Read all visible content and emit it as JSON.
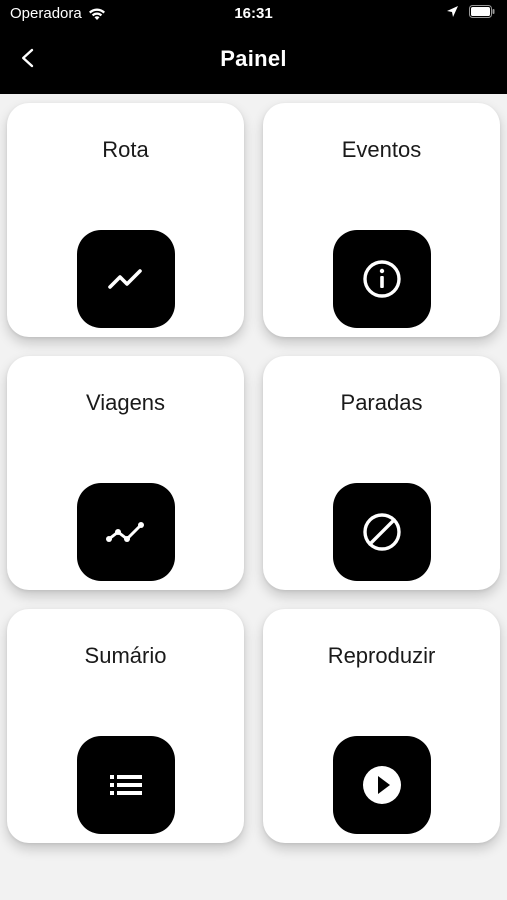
{
  "status_bar": {
    "carrier": "Operadora",
    "time": "16:31",
    "icons": [
      "wifi-icon",
      "location-icon",
      "battery-icon"
    ]
  },
  "header": {
    "title": "Painel",
    "back_icon": "chevron-left-icon"
  },
  "colors": {
    "header_bg": "#000000",
    "page_bg": "#f2f2f2",
    "card_bg": "#ffffff",
    "icon_tile_bg": "#000000"
  },
  "cards": [
    {
      "label": "Rota",
      "icon": "trending-up-icon"
    },
    {
      "label": "Eventos",
      "icon": "info-icon"
    },
    {
      "label": "Viagens",
      "icon": "timeline-icon"
    },
    {
      "label": "Paradas",
      "icon": "block-icon"
    },
    {
      "label": "Sumário",
      "icon": "list-icon"
    },
    {
      "label": "Reproduzir",
      "icon": "play-circle-icon"
    }
  ]
}
